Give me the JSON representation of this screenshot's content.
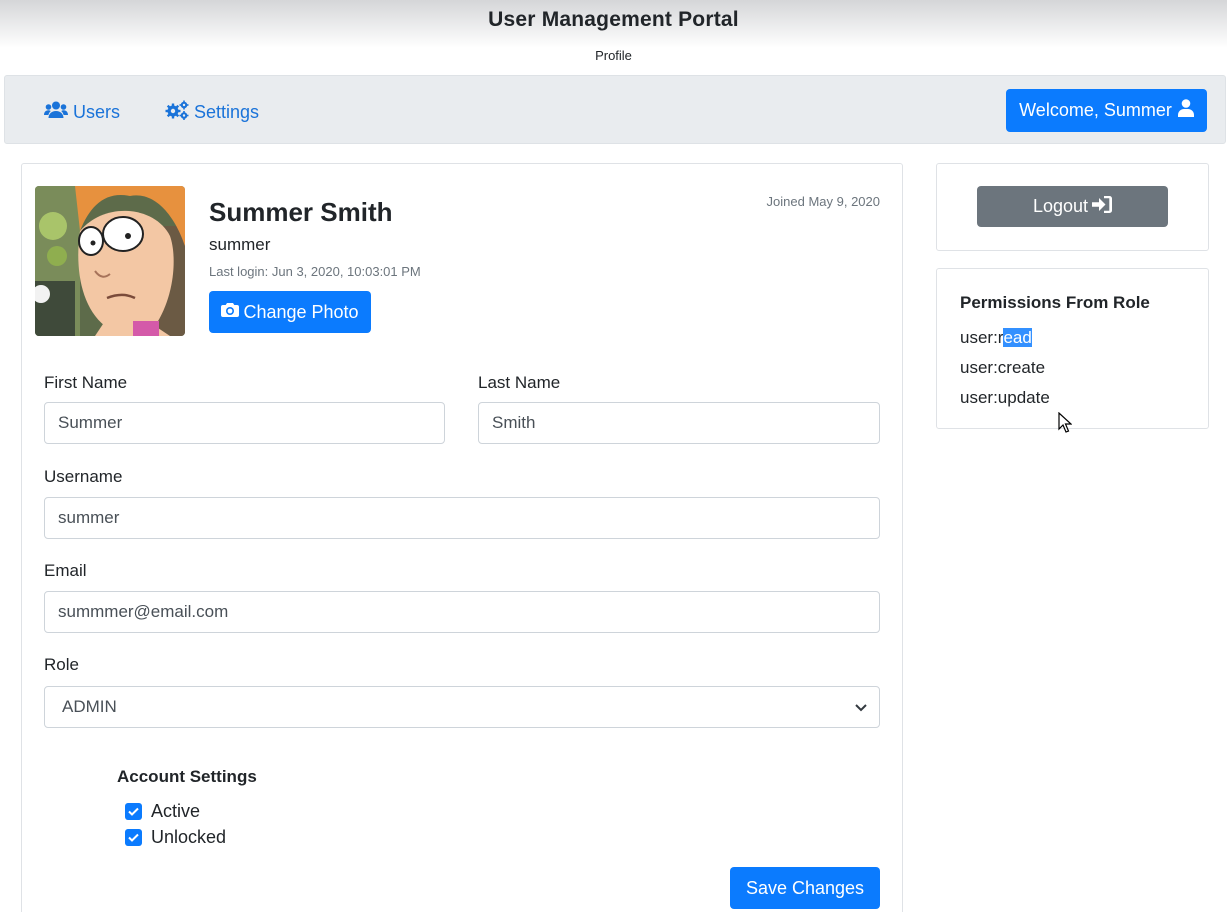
{
  "header": {
    "title": "User Management Portal",
    "subtitle": "Profile"
  },
  "nav": {
    "users_label": "Users",
    "settings_label": "Settings",
    "welcome_label": "Welcome, Summer"
  },
  "profile": {
    "name": "Summer Smith",
    "username": "summer",
    "last_login": "Last login: Jun 3, 2020, 10:03:01 PM",
    "joined": "Joined May 9, 2020",
    "change_photo_label": "Change Photo"
  },
  "form": {
    "first_name_label": "First Name",
    "first_name_value": "Summer",
    "last_name_label": "Last Name",
    "last_name_value": "Smith",
    "username_label": "Username",
    "username_value": "summer",
    "email_label": "Email",
    "email_value": "summmer@email.com",
    "role_label": "Role",
    "role_value": "ADMIN",
    "account_settings_title": "Account Settings",
    "active_label": "Active",
    "active_checked": true,
    "unlocked_label": "Unlocked",
    "unlocked_checked": true,
    "save_label": "Save Changes"
  },
  "sidebar": {
    "logout_label": "Logout",
    "permissions_title": "Permissions From Role",
    "permissions": [
      {
        "prefix": "user:r",
        "highlighted": "ead"
      },
      {
        "text": "user:create"
      },
      {
        "text": "user:update"
      }
    ]
  },
  "colors": {
    "primary": "#0b7bfe",
    "secondary": "#6c757d",
    "link": "#1a73d9",
    "selection": "#3390ff"
  }
}
